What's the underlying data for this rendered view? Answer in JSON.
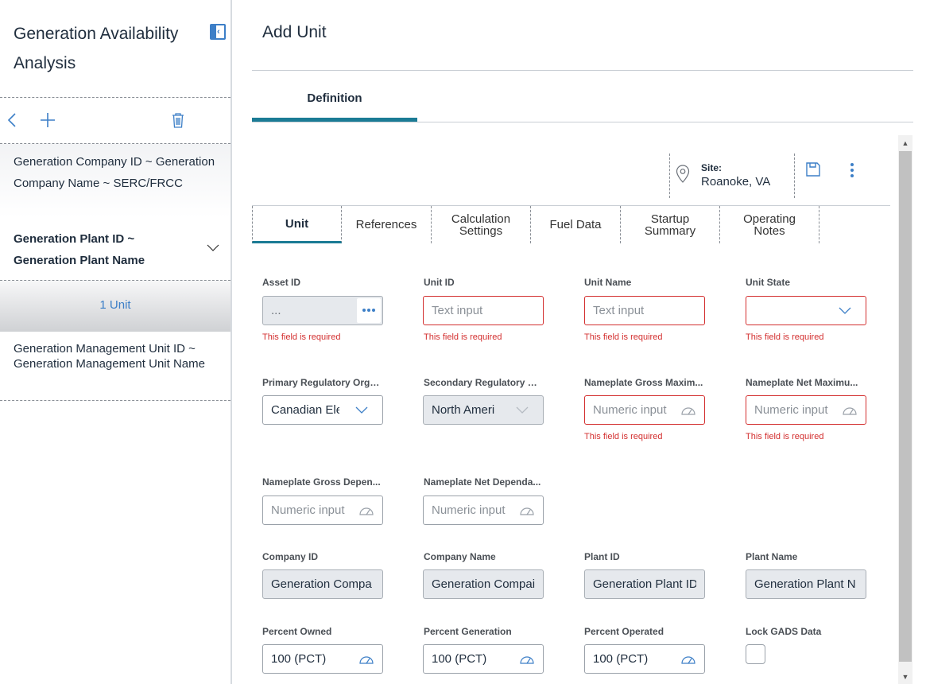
{
  "sidebar": {
    "title": "Generation Availability Analysis",
    "company": "Generation Company ID ~ Generation Company Name ~ SERC/FRCC",
    "plant": "Generation Plant ID ~ Generation Plant Name",
    "unit": "1 Unit",
    "management_unit": "Generation Management Unit ID ~ Generation Management Unit Name"
  },
  "main": {
    "title": "Add Unit",
    "tab": "Definition",
    "site_label": "Site:",
    "site_value": "Roanoke, VA"
  },
  "subtabs": [
    "Unit",
    "References",
    "Calculation\nSettings",
    "Fuel Data",
    "Startup\nSummary",
    "Operating\nNotes"
  ],
  "form": {
    "required_msg": "This field is required",
    "asset_id": {
      "label": "Asset ID",
      "value": "..."
    },
    "unit_id": {
      "label": "Unit ID",
      "placeholder": "Text input"
    },
    "unit_name": {
      "label": "Unit Name",
      "placeholder": "Text input"
    },
    "unit_state": {
      "label": "Unit State",
      "value": ""
    },
    "primary_reg": {
      "label": "Primary Regulatory Orga...",
      "value": "Canadian Ele"
    },
    "secondary_reg": {
      "label": "Secondary Regulatory Or...",
      "value": "North Ameri"
    },
    "np_gross_max": {
      "label": "Nameplate Gross Maxim...",
      "placeholder": "Numeric input"
    },
    "np_net_max": {
      "label": "Nameplate Net Maximu...",
      "placeholder": "Numeric input"
    },
    "np_gross_dep": {
      "label": "Nameplate Gross Depen...",
      "placeholder": "Numeric input"
    },
    "np_net_dep": {
      "label": "Nameplate Net Dependa...",
      "placeholder": "Numeric input"
    },
    "company_id": {
      "label": "Company ID",
      "value": "Generation Compa"
    },
    "company_name": {
      "label": "Company Name",
      "value": "Generation Compai"
    },
    "plant_id": {
      "label": "Plant ID",
      "value": "Generation Plant ID"
    },
    "plant_name": {
      "label": "Plant Name",
      "value": "Generation Plant N"
    },
    "percent_owned": {
      "label": "Percent Owned",
      "value": "100 (PCT)"
    },
    "percent_generation": {
      "label": "Percent Generation",
      "value": "100 (PCT)"
    },
    "percent_operated": {
      "label": "Percent Operated",
      "value": "100 (PCT)"
    },
    "lock_gads": {
      "label": "Lock GADS Data"
    }
  },
  "colors": {
    "accent": "#3d7fc7",
    "tab_underline": "#1b7b95",
    "error": "#d32f2f"
  }
}
